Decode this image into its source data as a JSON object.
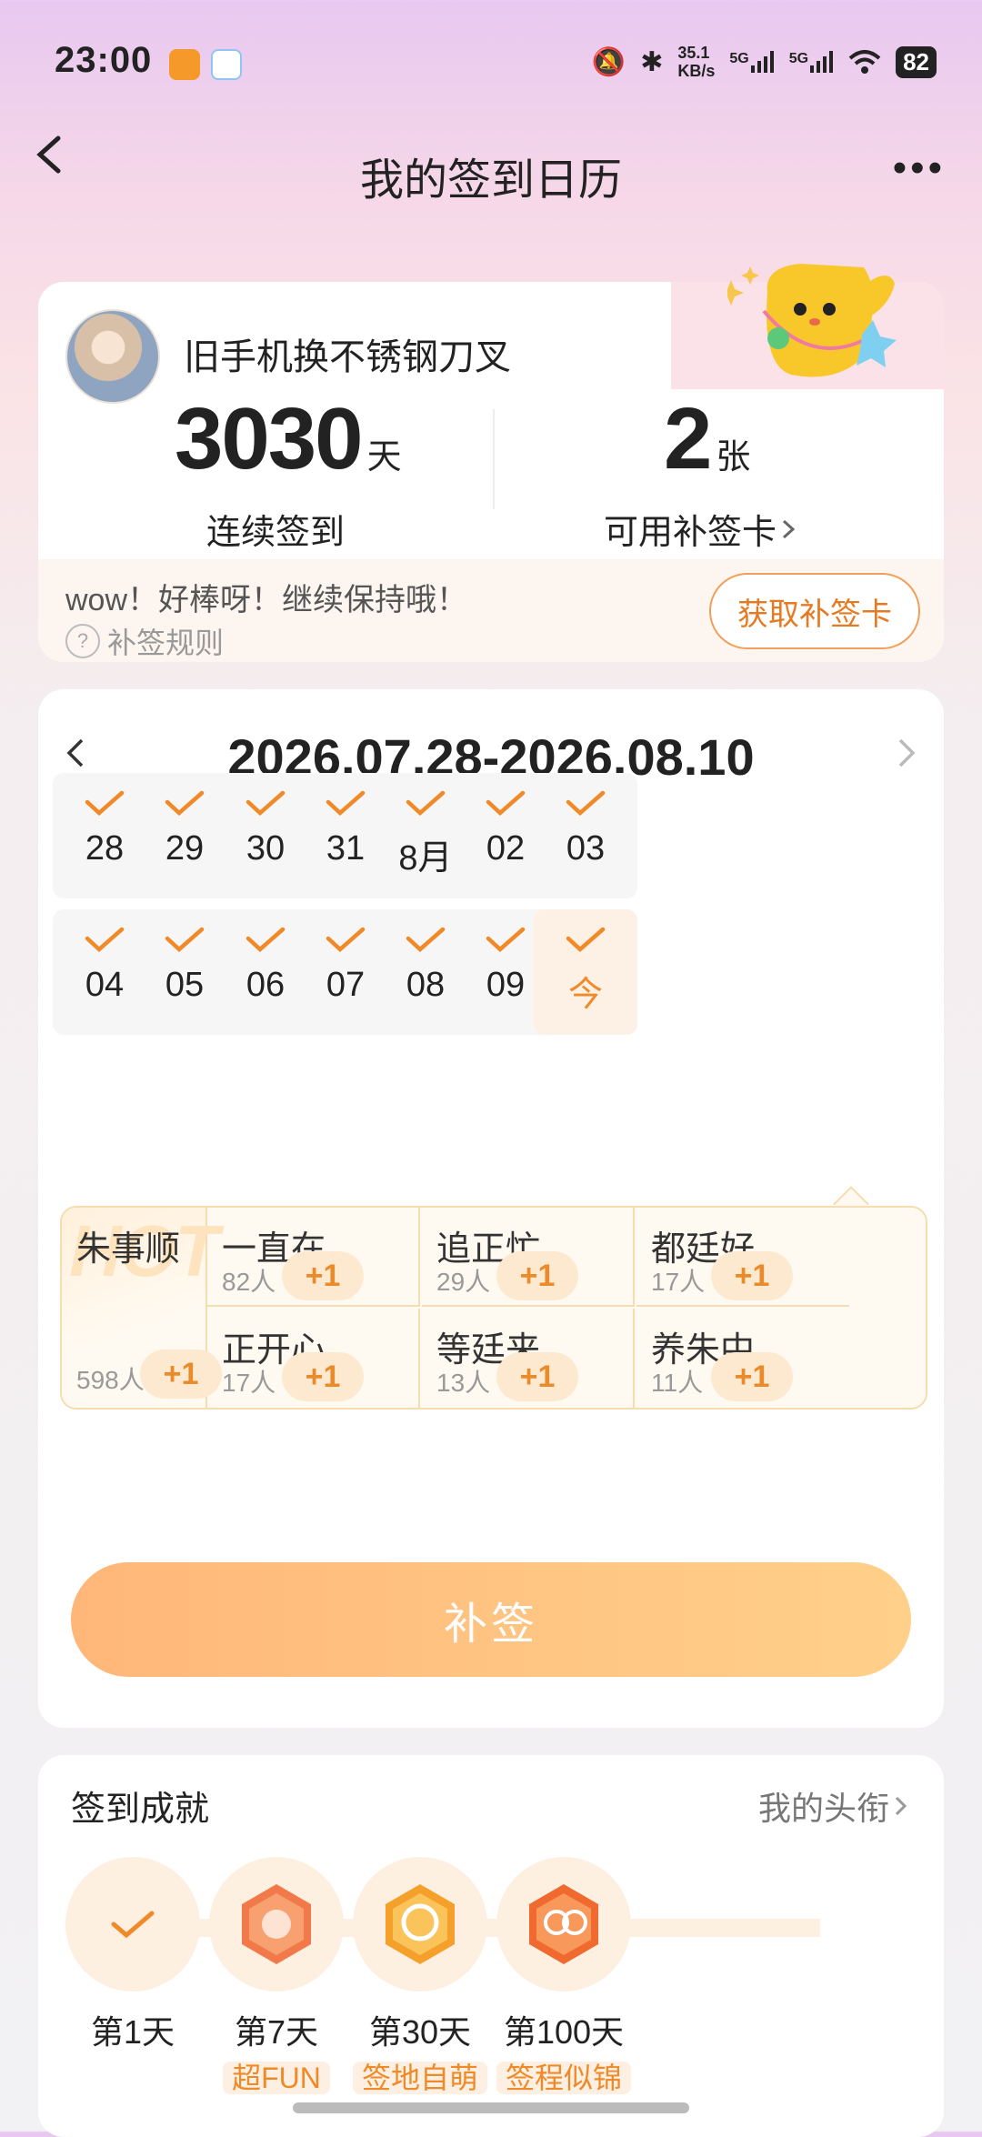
{
  "status_bar": {
    "time": "23:00",
    "net_speed": "35.1",
    "net_unit": "KB/s",
    "sig1": "5G",
    "sig2": "5G",
    "battery": "82"
  },
  "nav": {
    "title": "我的签到日历"
  },
  "user": {
    "name": "旧手机换不锈钢刀叉",
    "streak_value": "3030",
    "streak_unit": "天",
    "streak_label": "连续签到",
    "cards_value": "2",
    "cards_unit": "张",
    "cards_label": "可用补签卡",
    "tip": "wow！好棒呀！继续保持哦！",
    "rules_label": "补签规则",
    "get_card_button": "获取补签卡"
  },
  "calendar": {
    "range": "2026.07.28-2026.08.10",
    "days": [
      "28",
      "29",
      "30",
      "31",
      "8月",
      "02",
      "03",
      "04",
      "05",
      "06",
      "07",
      "08",
      "09",
      "今"
    ],
    "today_index": 13
  },
  "hot": {
    "watermark": "HOT",
    "featured": {
      "name": "朱事顺",
      "count": "598人",
      "plus": "+1"
    },
    "items": [
      {
        "name": "一直在",
        "count": "82人",
        "plus": "+1"
      },
      {
        "name": "追正忙",
        "count": "29人",
        "plus": "+1"
      },
      {
        "name": "都廷好",
        "count": "17人",
        "plus": "+1"
      },
      {
        "name": "正开心",
        "count": "17人",
        "plus": "+1"
      },
      {
        "name": "等廷来",
        "count": "13人",
        "plus": "+1"
      },
      {
        "name": "养朱中",
        "count": "11人",
        "plus": "+1"
      }
    ]
  },
  "makeup_button": "补签",
  "achievements": {
    "title": "签到成就",
    "link": "我的头衔",
    "items": [
      {
        "day": "第1天",
        "tag": ""
      },
      {
        "day": "第7天",
        "tag": "超FUN"
      },
      {
        "day": "第30天",
        "tag": "签地自萌"
      },
      {
        "day": "第100天",
        "tag": "签程似锦"
      }
    ]
  },
  "colors": {
    "accent": "#f08a28",
    "button_start": "#ffb779",
    "button_end": "#ffd08a"
  }
}
